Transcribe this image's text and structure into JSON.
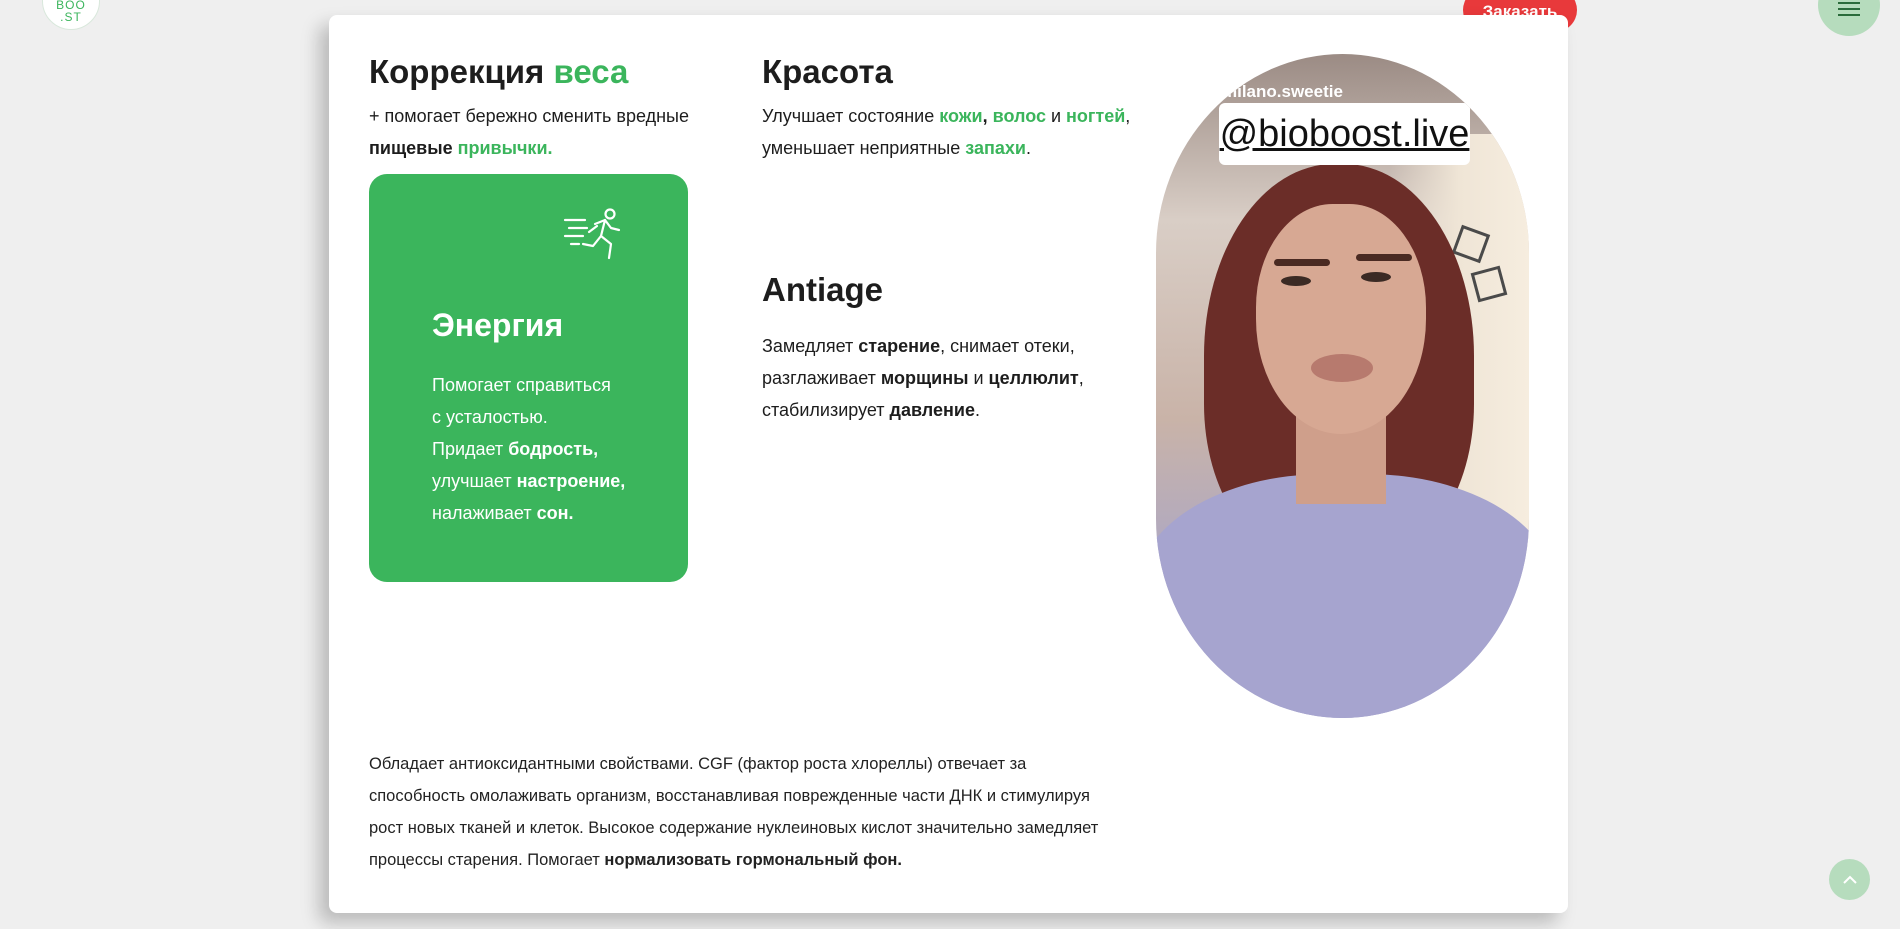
{
  "header": {
    "logo_text": "BIO\nBOO\n.ST",
    "order_button": "Заказать",
    "menu_icon": "hamburger-menu-icon"
  },
  "weight": {
    "title_part1": "Коррекция ",
    "title_part2": "веса",
    "text_part1": "+ помогает бережно сменить вредные ",
    "text_bold": "пищевые",
    "text_space": " ",
    "text_green": "привычки."
  },
  "energy": {
    "icon": "running-person-icon",
    "title": "Энергия",
    "line1": "Помогает справиться",
    "line2": "с усталостью.",
    "line3_a": "Придает ",
    "line3_b": "бодрость,",
    "line4_a": "улучшает ",
    "line4_b": "настроение,",
    "line5_a": "налаживает ",
    "line5_b": "сон."
  },
  "beauty": {
    "title": "Красота",
    "text_a": "Улучшает состояние ",
    "skin": "кожи",
    "comma1": ", ",
    "hair": "волос",
    "and": " и ",
    "nails": "ногтей",
    "text_b": ", уменьшает неприятные ",
    "smells": "запахи",
    "dot": "."
  },
  "antiage": {
    "title": "Antiage",
    "t1": "Замедляет ",
    "b1": "старение",
    "t2": ", снимает отеки, разглаживает ",
    "b2": "морщины",
    "t3": " и ",
    "b3": "целлюлит",
    "t4": ", стабилизирует ",
    "b4": "давление",
    "t5": "."
  },
  "video": {
    "username": "milano.sweetie",
    "handle": "@bioboost.live"
  },
  "description": {
    "text": "Обладает антиоксидантными свойствами. CGF (фактор роста хлореллы) отвечает за способность омолаживать организм, восстанавливая поврежденные части ДНК и стимулируя рост новых тканей и клеток. Высокое содержание нуклеиновых кислот значительно замедляет процессы старения. Помогает ",
    "bold": "нормализовать гормональный фон."
  },
  "scroll_top_icon": "chevron-up-icon",
  "colors": {
    "accent_green": "#3bb55c",
    "order_red": "#e8393b",
    "soft_green": "#b6dcbd"
  }
}
